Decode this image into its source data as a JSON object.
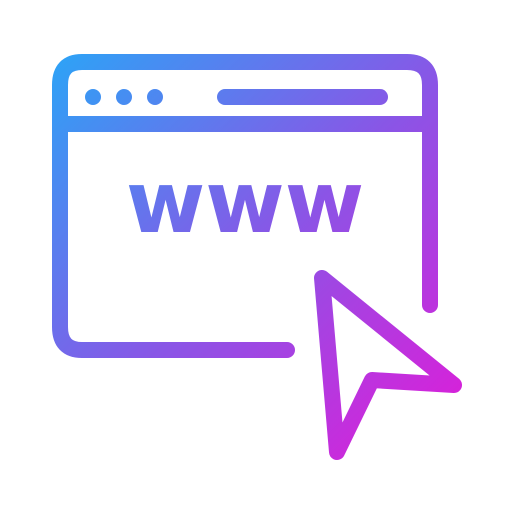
{
  "icon": {
    "name": "website-cursor-icon",
    "url_text": "www",
    "gradient": {
      "start": "#2ea2f6",
      "middle": "#8a55e6",
      "end": "#e21ad8"
    },
    "window_dots": 3
  }
}
